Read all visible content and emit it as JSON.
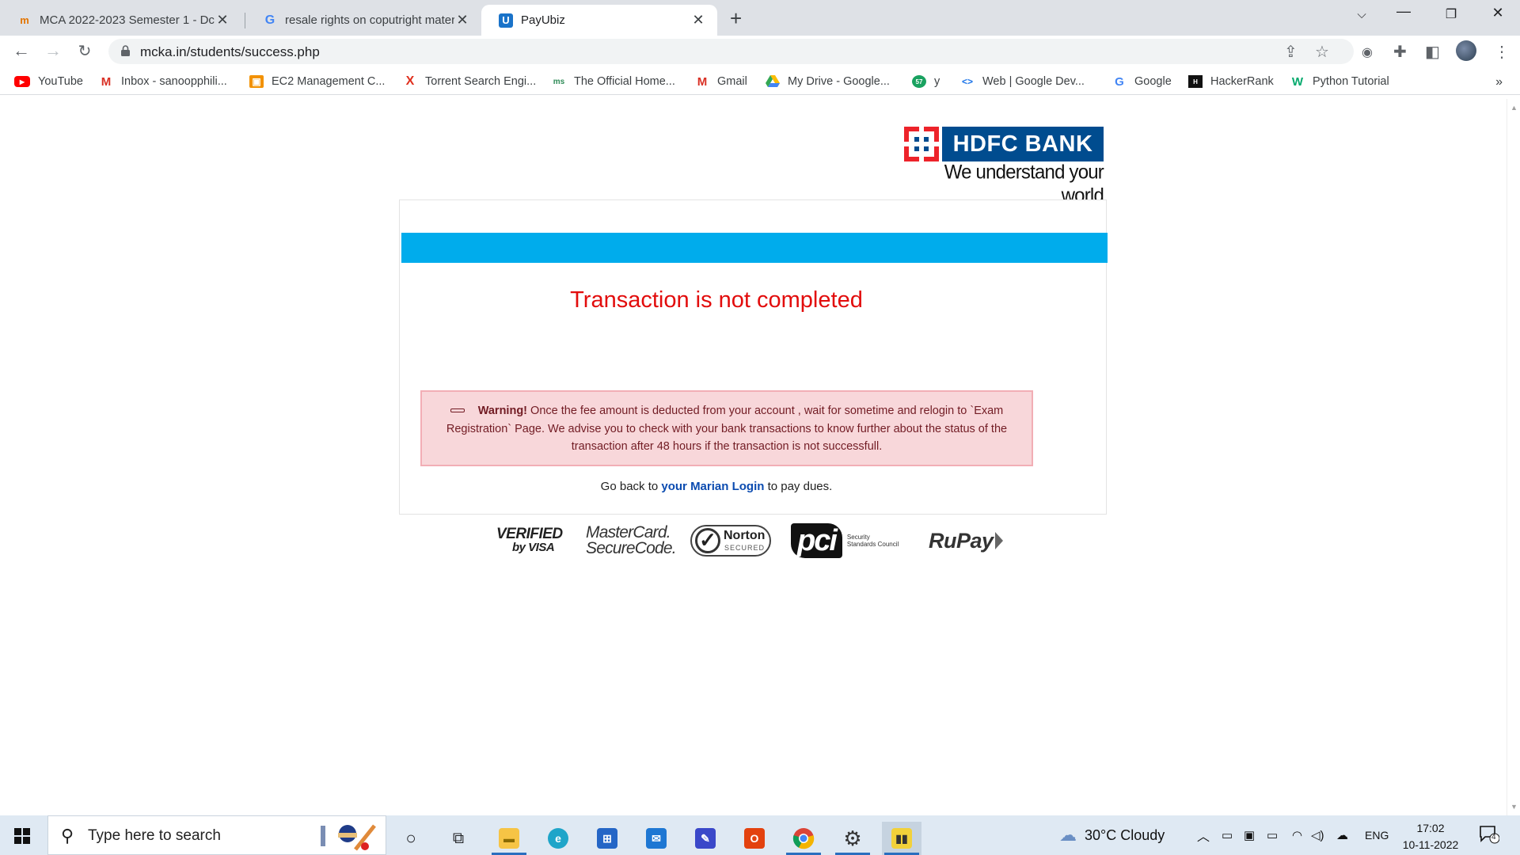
{
  "browser": {
    "tabs": [
      {
        "title": "MCA 2022-2023 Semester 1 - Dc",
        "active": false
      },
      {
        "title": "resale rights on coputright mater",
        "active": false
      },
      {
        "title": "PayUbiz",
        "active": true
      }
    ],
    "url": "mcka.in/students/success.php",
    "bookmarks": [
      {
        "label": "YouTube",
        "icon": "youtube-icon"
      },
      {
        "label": "Inbox - sanoopphili...",
        "icon": "gmail-icon"
      },
      {
        "label": "EC2 Management C...",
        "icon": "aws-icon"
      },
      {
        "label": "Torrent Search Engi...",
        "icon": "torrent-icon"
      },
      {
        "label": "The Official Home...",
        "icon": "site-icon"
      },
      {
        "label": "Gmail",
        "icon": "gmail-icon"
      },
      {
        "label": "My Drive - Google...",
        "icon": "drive-icon"
      },
      {
        "label": "y",
        "icon": "badge-icon"
      },
      {
        "label": "Web | Google Dev...",
        "icon": "devtools-icon"
      },
      {
        "label": "Google",
        "icon": "google-icon"
      },
      {
        "label": "HackerRank",
        "icon": "hackerrank-icon"
      },
      {
        "label": "Python Tutorial",
        "icon": "w3schools-icon"
      }
    ],
    "more_bookmarks": "»"
  },
  "page": {
    "bank_name": "HDFC BANK",
    "bank_tagline": "We understand your world",
    "status_message": "Transaction is not completed",
    "warning": {
      "label": "Warning!",
      "text": " Once the fee amount is deducted from your account , wait for sometime and relogin to `Exam Registration` Page. We advise you to check with your bank transactions to know further about the status of the transaction after 48 hours if the transaction is not successfull."
    },
    "go_back": {
      "prefix": "Go back to ",
      "link": "your Marian Login",
      "suffix": " to pay dues."
    },
    "badges": {
      "visa_line1": "VERIFIED",
      "visa_line2": "by VISA",
      "mc_line1": "MasterCard.",
      "mc_line2": "SecureCode.",
      "norton": "Norton",
      "norton_sub": "SECURED",
      "pci": "pci",
      "pci_sub1": "Security",
      "pci_sub2": "Standards Council",
      "rupay": "RuPay"
    }
  },
  "taskbar": {
    "search_placeholder": "Type here to search",
    "weather": "30°C  Cloudy",
    "language": "ENG",
    "time": "17:02",
    "date": "10-11-2022",
    "notification_count": "4",
    "colors": {
      "accent": "#2a6fbf",
      "background": "#dfe9f3"
    }
  },
  "colors": {
    "bank_blue": "#004c8f",
    "bank_red": "#ed232a",
    "status_red": "#e20c0c",
    "banner_blue": "#00acec",
    "alert_bg": "#f8d7da",
    "link_blue": "#0b4bb0"
  }
}
